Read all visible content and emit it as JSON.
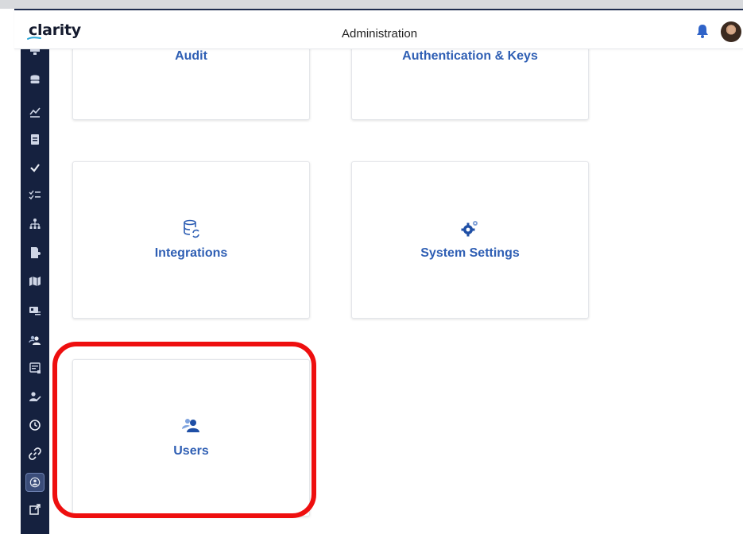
{
  "app": {
    "logo": "clarity",
    "title": "Administration"
  },
  "header_icons": [
    "bell-icon",
    "user-avatar"
  ],
  "sidebar": {
    "items": [
      {
        "icon": "monitor-icon"
      },
      {
        "icon": "database-icon"
      },
      {
        "icon": "trend-chart-icon"
      },
      {
        "icon": "clipboard-icon"
      },
      {
        "icon": "check-icon"
      },
      {
        "icon": "checklist-icon"
      },
      {
        "icon": "hierarchy-icon"
      },
      {
        "icon": "document-share-icon"
      },
      {
        "icon": "map-icon"
      },
      {
        "icon": "id-card-icon"
      },
      {
        "icon": "users-icon"
      },
      {
        "icon": "form-icon"
      },
      {
        "icon": "user-edit-icon"
      },
      {
        "icon": "clock-icon"
      },
      {
        "icon": "link-icon"
      },
      {
        "icon": "admin-settings-icon",
        "active": true
      },
      {
        "icon": "external-link-icon"
      }
    ]
  },
  "cards": {
    "audit": {
      "label": "Audit"
    },
    "auth_keys": {
      "label": "Authentication & Keys"
    },
    "integrations": {
      "label": "Integrations",
      "icon": "database-sync-icon"
    },
    "system_settings": {
      "label": "System Settings",
      "icon": "gears-icon"
    },
    "users": {
      "label": "Users",
      "icon": "users-icon"
    }
  },
  "colors": {
    "sidebar_bg": "#15213f",
    "accent_blue": "#2f5fb4",
    "highlight_red": "#ee0f0f"
  }
}
